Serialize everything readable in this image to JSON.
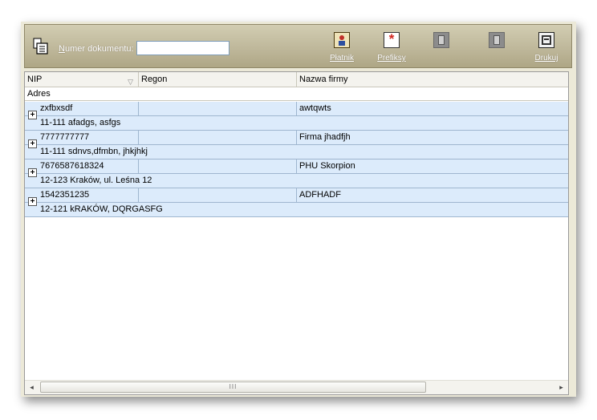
{
  "toolbar": {
    "doc_label_underlined": "N",
    "doc_label_rest": "umer dokumentu:",
    "doc_value": "",
    "buttons": [
      {
        "label": "Płatnik",
        "icon": "person-icon",
        "enabled": true
      },
      {
        "label": "Prefiksy",
        "icon": "asterisk-icon",
        "enabled": true
      },
      {
        "label": "",
        "icon": "document-icon",
        "enabled": false
      },
      {
        "label": "",
        "icon": "document-icon",
        "enabled": false
      },
      {
        "label": "Drukuj",
        "icon": "printer-icon",
        "enabled": true
      }
    ]
  },
  "grid": {
    "columns": [
      "NIP",
      "Regon",
      "Nazwa firmy"
    ],
    "secondary_header": "Adres",
    "expand_symbol": "+",
    "records": [
      {
        "nip": "zxfbxsdf",
        "regon": "",
        "nazwa": "awtqwts",
        "adres": "11-111 afadgs, asfgs"
      },
      {
        "nip": "7777777777",
        "regon": "",
        "nazwa": "Firma jhadfjh",
        "adres": "11-111 sdnvs,dfmbn, jhkjhkj"
      },
      {
        "nip": "7676587618324",
        "regon": "",
        "nazwa": "PHU Skorpion",
        "adres": "12-123 Kraków, ul. Leśna 12"
      },
      {
        "nip": "1542351235",
        "regon": "",
        "nazwa": "ADFHADF",
        "adres": "12-121 kRAKÓW, DQRGASFG"
      }
    ]
  },
  "scrollbar": {
    "thumb_grip": "III",
    "left_arrow": "◂",
    "right_arrow": "▸"
  }
}
